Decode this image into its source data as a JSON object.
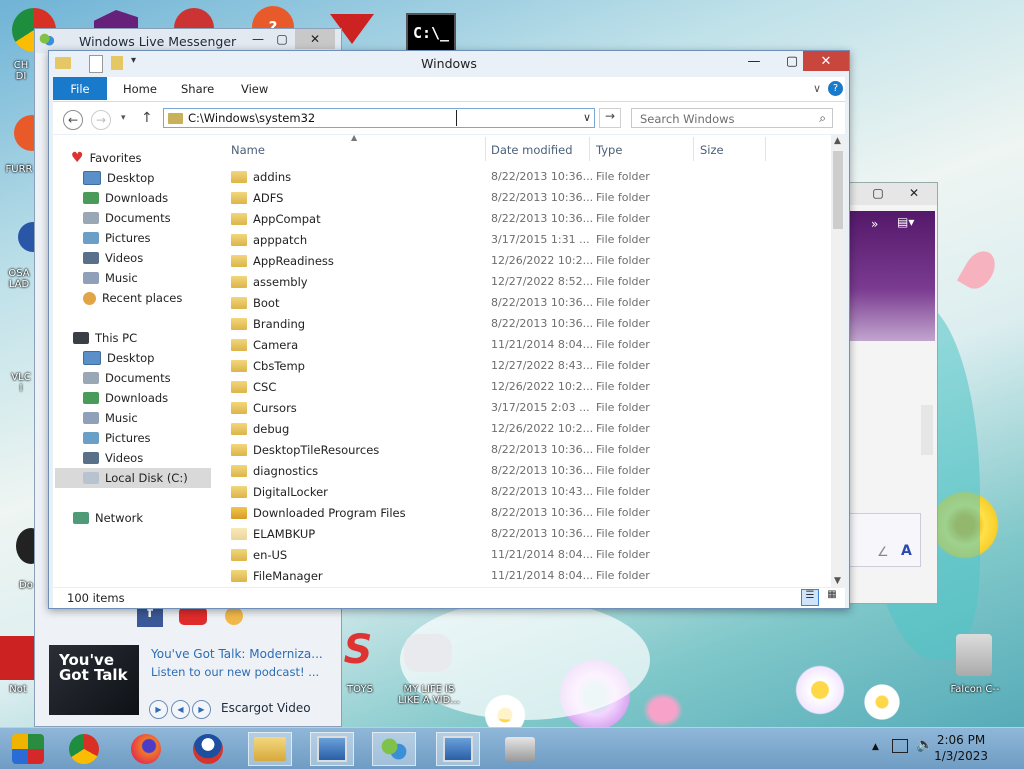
{
  "desktop": {
    "icons": [
      {
        "label": "CH\nDI",
        "color": "#d44"
      },
      {
        "label": "FURR",
        "color": "#e63"
      },
      {
        "label": "OSA\nLAD",
        "color": "#36a"
      },
      {
        "label": "VLC\nI",
        "color": "#f80"
      },
      {
        "label": "Do",
        "color": "#333"
      },
      {
        "label": "Not",
        "color": "#c22"
      },
      {
        "label": "TOYS",
        "color": "#c22"
      },
      {
        "label": "MY LIFE IS\nLIKE A VID...",
        "color": "#888"
      },
      {
        "label": "Falcon C--",
        "color": "#777"
      }
    ]
  },
  "messenger": {
    "title": "Windows Live Messenger",
    "ad": {
      "thumb_text": "You've Got Talk",
      "headline": "You've Got Talk: Moderniza...",
      "subtext": "Listen to our new podcast! ...",
      "source": "Escargot Video"
    }
  },
  "explorer": {
    "title": "Windows",
    "ribbon_tabs": [
      "File",
      "Home",
      "Share",
      "View"
    ],
    "address_path": "C:\\Windows\\system32",
    "search_placeholder": "Search Windows",
    "nav": {
      "favorites_label": "Favorites",
      "favorites": [
        "Desktop",
        "Downloads",
        "Documents",
        "Pictures",
        "Videos",
        "Music",
        "Recent places"
      ],
      "thispc_label": "This PC",
      "thispc": [
        "Desktop",
        "Documents",
        "Downloads",
        "Music",
        "Pictures",
        "Videos",
        "Local Disk (C:)"
      ],
      "network_label": "Network"
    },
    "columns": [
      "Name",
      "Date modified",
      "Type",
      "Size"
    ],
    "files": [
      {
        "name": "addins",
        "date": "8/22/2013 10:36...",
        "type": "File folder"
      },
      {
        "name": "ADFS",
        "date": "8/22/2013 10:36...",
        "type": "File folder"
      },
      {
        "name": "AppCompat",
        "date": "8/22/2013 10:36...",
        "type": "File folder"
      },
      {
        "name": "apppatch",
        "date": "3/17/2015 1:31 ...",
        "type": "File folder"
      },
      {
        "name": "AppReadiness",
        "date": "12/26/2022 10:2...",
        "type": "File folder"
      },
      {
        "name": "assembly",
        "date": "12/27/2022 8:52...",
        "type": "File folder"
      },
      {
        "name": "Boot",
        "date": "8/22/2013 10:36...",
        "type": "File folder"
      },
      {
        "name": "Branding",
        "date": "8/22/2013 10:36...",
        "type": "File folder"
      },
      {
        "name": "Camera",
        "date": "11/21/2014 8:04...",
        "type": "File folder"
      },
      {
        "name": "CbsTemp",
        "date": "12/27/2022 8:43...",
        "type": "File folder"
      },
      {
        "name": "CSC",
        "date": "12/26/2022 10:2...",
        "type": "File folder"
      },
      {
        "name": "Cursors",
        "date": "3/17/2015 2:03 ...",
        "type": "File folder"
      },
      {
        "name": "debug",
        "date": "12/26/2022 10:2...",
        "type": "File folder"
      },
      {
        "name": "DesktopTileResources",
        "date": "8/22/2013 10:36...",
        "type": "File folder"
      },
      {
        "name": "diagnostics",
        "date": "8/22/2013 10:36...",
        "type": "File folder"
      },
      {
        "name": "DigitalLocker",
        "date": "8/22/2013 10:43...",
        "type": "File folder"
      },
      {
        "name": "Downloaded Program Files",
        "date": "8/22/2013 10:36...",
        "type": "File folder"
      },
      {
        "name": "ELAMBKUP",
        "date": "8/22/2013 10:36...",
        "type": "File folder"
      },
      {
        "name": "en-US",
        "date": "11/21/2014 8:04...",
        "type": "File folder"
      },
      {
        "name": "FileManager",
        "date": "11/21/2014 8:04...",
        "type": "File folder"
      }
    ],
    "status_count": "100 items"
  },
  "taskbar": {
    "time": "2:06 PM",
    "date": "1/3/2023"
  },
  "colors": {
    "accent": "#1979ca",
    "close": "#c8463d",
    "taskbar": "#7fa9cd"
  }
}
